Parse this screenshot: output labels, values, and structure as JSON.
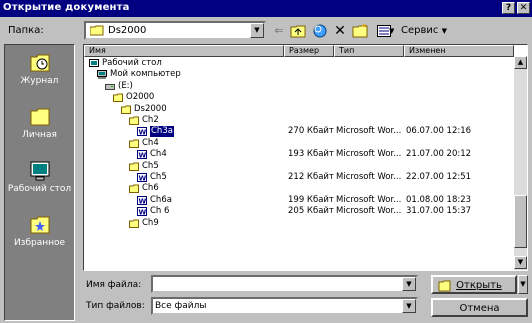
{
  "window": {
    "title": "Открытие документа",
    "help_glyph": "?",
    "close_glyph": "✕"
  },
  "toolbar": {
    "folder_label": "Папка:",
    "folder_value": "Ds2000",
    "service_label": "Сервис"
  },
  "places": [
    {
      "label": "Журнал",
      "icon": "history-icon"
    },
    {
      "label": "Личная",
      "icon": "personal-folder-icon"
    },
    {
      "label": "Рабочий стол",
      "icon": "desktop-icon"
    },
    {
      "label": "Избранное",
      "icon": "favorites-icon"
    }
  ],
  "columns": {
    "name": "Имя",
    "size": "Размер",
    "type": "Тип",
    "modified": "Изменен"
  },
  "items": [
    {
      "name": "Рабочий стол",
      "icon": "desktop-icon",
      "level": 0,
      "size": "",
      "type": "",
      "modified": ""
    },
    {
      "name": "Мой компьютер",
      "icon": "computer-icon",
      "level": 1,
      "size": "",
      "type": "",
      "modified": ""
    },
    {
      "name": "(E:)",
      "icon": "drive-icon",
      "level": 2,
      "size": "",
      "type": "",
      "modified": ""
    },
    {
      "name": "O2000",
      "icon": "folder-icon",
      "level": 3,
      "size": "",
      "type": "",
      "modified": ""
    },
    {
      "name": "Ds2000",
      "icon": "folder-icon",
      "level": 4,
      "size": "",
      "type": "",
      "modified": ""
    },
    {
      "name": "Ch2",
      "icon": "folder-icon",
      "level": 5,
      "size": "",
      "type": "",
      "modified": ""
    },
    {
      "name": "Ch3a",
      "icon": "word-doc-icon",
      "level": 6,
      "size": "270 Кбайт",
      "type": "Microsoft Wor...",
      "modified": "06.07.00 12:16",
      "selected": true
    },
    {
      "name": "Ch4",
      "icon": "folder-icon",
      "level": 5,
      "size": "",
      "type": "",
      "modified": ""
    },
    {
      "name": "Ch4",
      "icon": "word-doc-icon",
      "level": 6,
      "size": "193 Кбайт",
      "type": "Microsoft Wor...",
      "modified": "21.07.00 20:12"
    },
    {
      "name": "Ch5",
      "icon": "folder-icon",
      "level": 5,
      "size": "",
      "type": "",
      "modified": ""
    },
    {
      "name": "Ch5",
      "icon": "word-doc-icon",
      "level": 6,
      "size": "212 Кбайт",
      "type": "Microsoft Wor...",
      "modified": "22.07.00 12:51"
    },
    {
      "name": "Ch6",
      "icon": "folder-icon",
      "level": 5,
      "size": "",
      "type": "",
      "modified": ""
    },
    {
      "name": "Ch6a",
      "icon": "word-doc-icon",
      "level": 6,
      "size": "199 Кбайт",
      "type": "Microsoft Wor...",
      "modified": "01.08.00 18:23"
    },
    {
      "name": "Ch 6",
      "icon": "word-doc-icon",
      "level": 6,
      "size": "205 Кбайт",
      "type": "Microsoft Wor...",
      "modified": "31.07.00 15:37"
    },
    {
      "name": "Ch9",
      "icon": "folder-icon",
      "level": 5,
      "size": "",
      "type": "",
      "modified": ""
    }
  ],
  "footer": {
    "filename_label": "Имя файла:",
    "filename_value": "",
    "filetype_label": "Тип файлов:",
    "filetype_value": "Все файлы",
    "open_label": "Открыть",
    "cancel_label": "Отмена"
  }
}
